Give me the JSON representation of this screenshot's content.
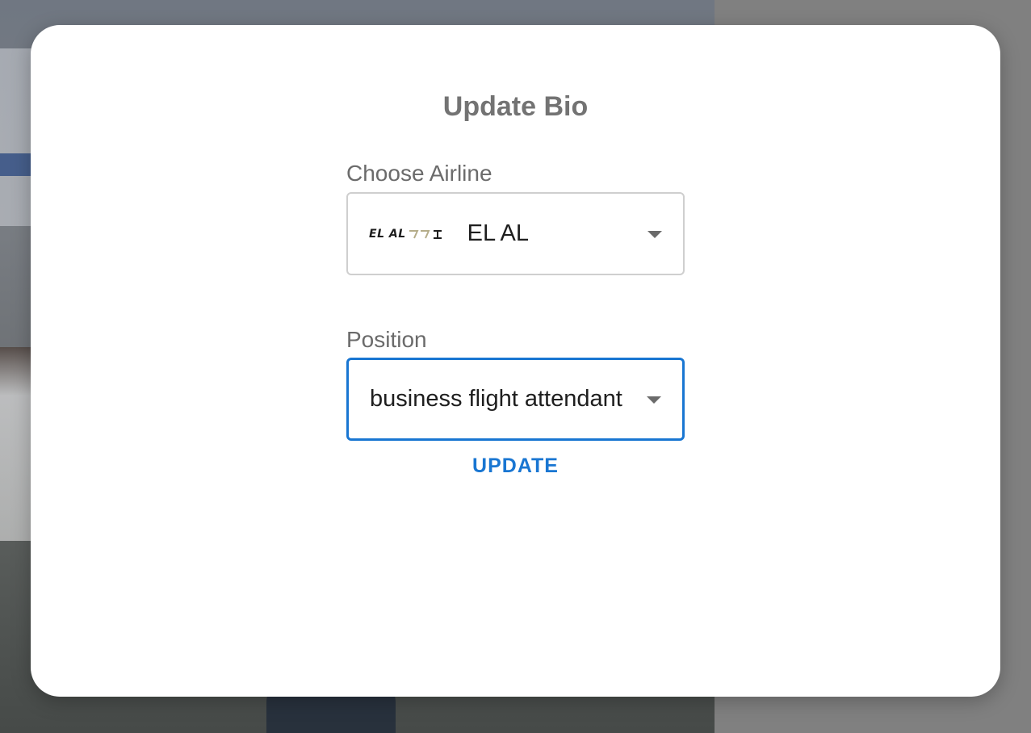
{
  "dialog": {
    "title": "Update Bio"
  },
  "airline_field": {
    "label": "Choose Airline",
    "selected_value": "EL AL",
    "logo_text": "EL AL"
  },
  "position_field": {
    "label": "Position",
    "selected_value": "business flight attendant"
  },
  "actions": {
    "update_label": "UPDATE"
  },
  "colors": {
    "accent": "#1976d2",
    "title": "#737373",
    "overlay": "#808080"
  }
}
